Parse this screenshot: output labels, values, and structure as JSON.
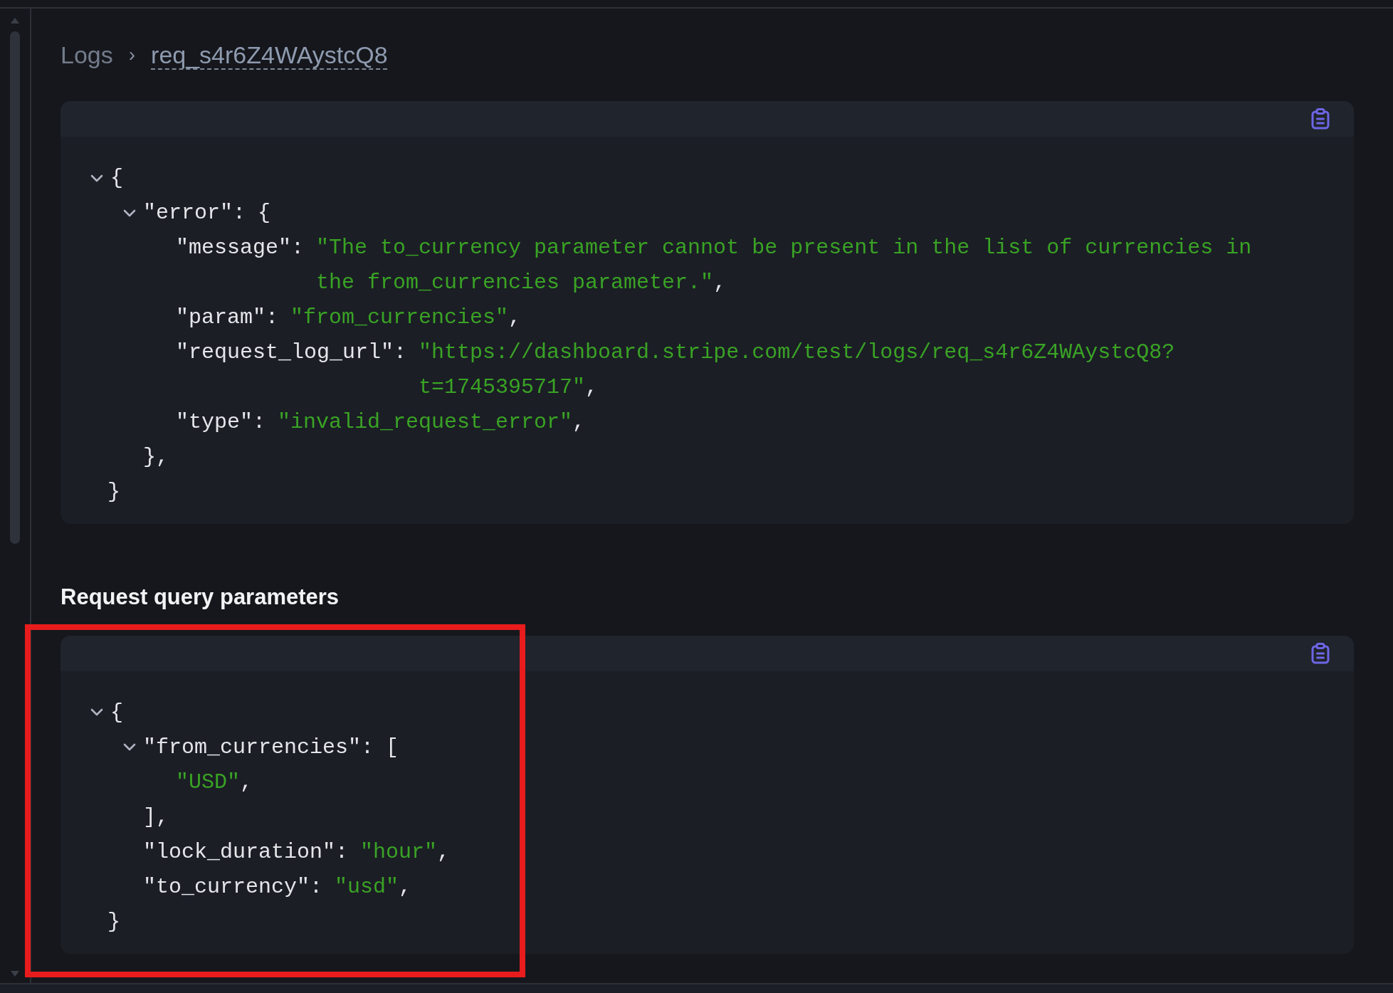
{
  "breadcrumb": {
    "parent": "Logs",
    "separator": "›",
    "current": "req_s4r6Z4WAystcQ8"
  },
  "response_block": {
    "root": {
      "kind": "object",
      "expanded": true,
      "open": "{",
      "close": "}",
      "children": [
        {
          "kind": "object",
          "key": "\"error\":",
          "expanded": true,
          "open": "{",
          "close": "},",
          "children": [
            {
              "kind": "string",
              "key": "\"message\":",
              "value_lines": [
                "\"The to_currency parameter cannot be present in the list of currencies in",
                "the from_currencies parameter.\""
              ],
              "trailing": ","
            },
            {
              "kind": "string",
              "key": "\"param\":",
              "value_lines": [
                "\"from_currencies\""
              ],
              "trailing": ","
            },
            {
              "kind": "string",
              "key": "\"request_log_url\":",
              "value_lines": [
                "\"https://dashboard.stripe.com/test/logs/req_s4r6Z4WAystcQ8?",
                "t=1745395717\""
              ],
              "trailing": ","
            },
            {
              "kind": "string",
              "key": "\"type\":",
              "value_lines": [
                "\"invalid_request_error\""
              ],
              "trailing": ","
            }
          ]
        }
      ]
    }
  },
  "section_heading": "Request query parameters",
  "query_block": {
    "highlighted": true,
    "root": {
      "kind": "object",
      "expanded": true,
      "open": "{",
      "close": "}",
      "children": [
        {
          "kind": "array",
          "key": "\"from_currencies\":",
          "expanded": true,
          "open": "[",
          "close": "],",
          "children": [
            {
              "kind": "string",
              "value_lines": [
                "\"USD\""
              ],
              "trailing": ","
            }
          ]
        },
        {
          "kind": "string",
          "key": "\"lock_duration\":",
          "value_lines": [
            "\"hour\""
          ],
          "trailing": ","
        },
        {
          "kind": "string",
          "key": "\"to_currency\":",
          "value_lines": [
            "\"usd\""
          ],
          "trailing": ","
        }
      ]
    }
  }
}
